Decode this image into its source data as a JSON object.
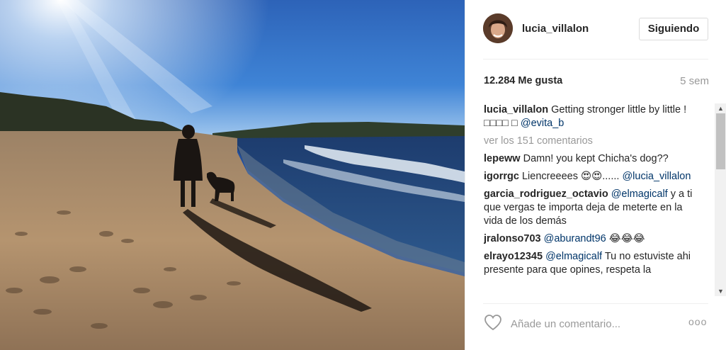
{
  "post": {
    "username": "lucia_villalon",
    "follow_label": "Siguiendo",
    "likes": "12.284 Me gusta",
    "time": "5 sem"
  },
  "caption": {
    "user": "lucia_villalon",
    "text": "Getting stronger little by little ! □□□□ □",
    "mention": "@evita_b"
  },
  "view_all": "ver los 151 comentarios",
  "comments": [
    {
      "user": "lepeww",
      "text": "Damn! you kept Chicha's dog??",
      "mention": ""
    },
    {
      "user": "igorrgc",
      "text": "Liencreeees 😍😍......",
      "mention": "@lucia_villalon"
    },
    {
      "user": "garcia_rodriguez_octavio",
      "mention": "@elmagicalf",
      "text": "y a ti que vergas te importa deja de meterte en la vida de los demás"
    },
    {
      "user": "jralonso703",
      "mention": "@aburandt96",
      "text": "😂😂😂"
    },
    {
      "user": "elrayo12345",
      "mention": "@elmagicalf",
      "text": "Tu no estuviste ahi presente para que opines, respeta la"
    }
  ],
  "footer": {
    "add_comment_placeholder": "Añade un comentario...",
    "more_label": "ooo"
  },
  "icons": {
    "like": "heart-icon",
    "more": "more-options-icon"
  },
  "colors": {
    "mention": "#003569",
    "muted": "#999999",
    "text": "#262626"
  }
}
